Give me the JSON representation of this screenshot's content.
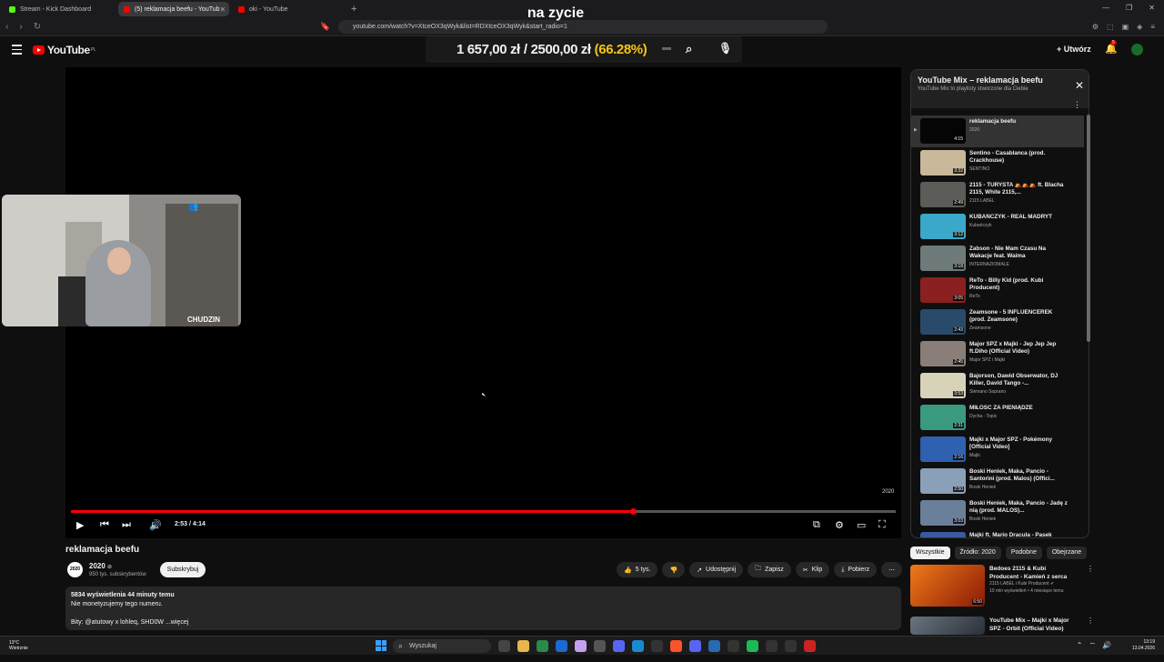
{
  "browser": {
    "tabs": [
      {
        "label": "Stream - Kick Dashboard",
        "color": "#53fc18",
        "active": false
      },
      {
        "label": "(5) reklamacja beefu - YouTub",
        "color": "#ff0000",
        "active": true
      },
      {
        "label": "oki - YouTube",
        "color": "#ff0000",
        "active": false
      }
    ],
    "new_tab": "+",
    "url": "youtube.com/watch?v=XtceOX3qWyk&list=RDXtceOX3qWyk&start_radio=1"
  },
  "overlay": {
    "title": "na zycie",
    "goal_current": "1 657,00 zł",
    "goal_sep": "/",
    "goal_target": "2500,00 zł",
    "goal_pct": "(66.28%)",
    "cam_label": "CHUDZIN"
  },
  "youtube": {
    "logo_text": "YouTube",
    "logo_region": "PL",
    "create_label": "+ Utwórz",
    "notification_count": "5"
  },
  "player": {
    "time": "2:53 / 4:14",
    "progress": 0.6814,
    "watermark": "2020"
  },
  "video": {
    "title": "reklamacja beefu",
    "channel": "2020",
    "channel_avatar": "2020",
    "subscribers": "950 tys. subskrybentów",
    "subscribe_label": "Subskrybuj",
    "likes": "5 tys.",
    "share": "Udostępnij",
    "save": "Zapisz",
    "clip": "Klip",
    "download": "Pobierz",
    "views_line": "5834 wyświetlenia  44 minuty temu",
    "desc_line1": "Nie monetyzujemy tego numeru.",
    "desc_line2": "Bity: @atutowy x lohleq, SHD0W ...więcej"
  },
  "mix": {
    "title": "YouTube Mix – reklamacja beefu",
    "subtitle": "YouTube Mix to playlisty stworzone dla Ciebie",
    "items": [
      {
        "title": "reklamacja beefu",
        "author": "2020",
        "duration": "4:15",
        "color": "#050505"
      },
      {
        "title": "Sentino - Casablanca (prod. Crackhouse)",
        "author": "SENTINO",
        "duration": "3:32",
        "color": "#c9b89a"
      },
      {
        "title": "2115 - TURYSTA ⛺⛺⛺ ft. Blacha 2115, White 2115,...",
        "author": "2115 LABEL",
        "duration": "2:49",
        "color": "#5c5c58"
      },
      {
        "title": "KUBAŃCZYK - REAL MADRYT",
        "author": "Kubańczyk",
        "duration": "3:12",
        "color": "#3aa8c9"
      },
      {
        "title": "Żabson - Nie Mam Czasu Na Wakacje feat. Waima",
        "author": "INTERNAZIOMALE",
        "duration": "3:18",
        "color": "#6f7a7a"
      },
      {
        "title": "ReTo - Billy Kid (prod. Kubi Producent)",
        "author": "ReTo",
        "duration": "3:05",
        "color": "#8a2020"
      },
      {
        "title": "Zeamsone - 5 INFLUENCEREK (prod. Zeamsone)",
        "author": "Zeamsone",
        "duration": "2:43",
        "color": "#2a4a6a"
      },
      {
        "title": "Major SPZ x Majki - Jep Jep Jep ft.Diho (Official Video)",
        "author": "Major SPZ i Majki",
        "duration": "2:45",
        "color": "#8a7f78"
      },
      {
        "title": "Bajorson, Dawid Obserwator, DJ Killer, David Tango -...",
        "author": "Slemano Soprano",
        "duration": "3:53",
        "color": "#d8d2b8"
      },
      {
        "title": "MIŁOŚĆ ZA PIENIĄDZE",
        "author": "Dycha - Topic",
        "duration": "2:31",
        "color": "#3a9a80"
      },
      {
        "title": "Majki x Major SPZ - Pokémony [Official Video]",
        "author": "Majki",
        "duration": "2:16",
        "color": "#3060b0"
      },
      {
        "title": "Boski Heniek, Maka, Pancio - Santorini (prod. Malos) (Offici...",
        "author": "Boski Heniek",
        "duration": "2:50",
        "color": "#8aa0b8"
      },
      {
        "title": "Boski Heniek, Maka, Pancio - Jadę z nią (prod. MALOS)...",
        "author": "Boski Heniek",
        "duration": "3:03",
        "color": "#6a7f9a"
      },
      {
        "title": "Majki ft. Mario Dracula - Pasek Gucci (La La La) (Majki Remix)",
        "author": "",
        "duration": "",
        "color": "#3a5aa0"
      }
    ]
  },
  "chips": [
    {
      "label": "Wszystkie",
      "active": true
    },
    {
      "label": "Źródło: 2020",
      "active": false
    },
    {
      "label": "Podobne",
      "active": false
    },
    {
      "label": "Obejrzane",
      "active": false
    }
  ],
  "recommendations": [
    {
      "title": "Bedoes 2115 & Kubi Producent - Kamień z serca",
      "channel": "2115 LABEL i Kubi Producent ✔",
      "views": "10 mln wyświetleń • 4 miesiące temu",
      "duration": "6:50",
      "color": "#c2451a"
    },
    {
      "title": "YouTube Mix – Majki x Major SPZ - Orbit (Official Video)",
      "channel": "",
      "views": "",
      "duration": "",
      "color": "#4a5560"
    }
  ],
  "taskbar": {
    "temp": "13°C",
    "weather": "Wietrznie",
    "search": "Wyszukaj",
    "time": "13:19",
    "date": "13.04.2026"
  }
}
